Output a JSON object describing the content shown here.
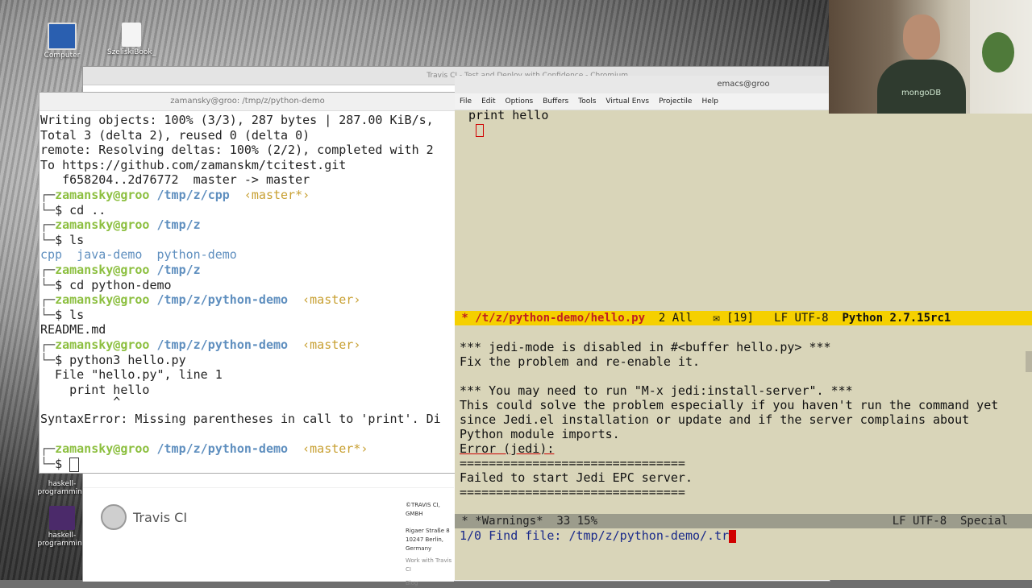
{
  "desktop": {
    "icons": [
      {
        "label": "Computer"
      },
      {
        "label": "SzeliskiBook_"
      },
      {
        "label": "haskell-programming"
      },
      {
        "label": "haskell-programming"
      }
    ]
  },
  "browser": {
    "title": "Travis CI - Test and Deploy with Confidence - Chromium",
    "logo_text": "Travis CI",
    "footer": {
      "copyright": "©TRAVIS CI, GMBH",
      "address_lines": [
        "Rigaer Straße 8",
        "10247 Berlin,",
        "Germany"
      ],
      "links": [
        "Work with Travis CI",
        "Blog"
      ]
    }
  },
  "terminal": {
    "title": "zamansky@groo: /tmp/z/python-demo",
    "lines": {
      "l1": "Writing objects: 100% (3/3), 287 bytes | 287.00 KiB/s,",
      "l2": "Total 3 (delta 2), reused 0 (delta 0)",
      "l3": "remote: Resolving deltas: 100% (2/2), completed with 2",
      "l4": "To https://github.com/zamanskm/tcitest.git",
      "l5": "   f658204..2d76772  master -> master"
    },
    "prompts": [
      {
        "user": "zamansky@groo",
        "path": "/tmp/z/cpp",
        "branch": "‹master*›",
        "cmd": "cd .."
      },
      {
        "user": "zamansky@groo",
        "path": "/tmp/z",
        "branch": "",
        "cmd": "ls"
      },
      {
        "user": "zamansky@groo",
        "path": "/tmp/z",
        "branch": "",
        "cmd": "cd python-demo"
      },
      {
        "user": "zamansky@groo",
        "path": "/tmp/z/python-demo",
        "branch": "‹master›",
        "cmd": "ls"
      },
      {
        "user": "zamansky@groo",
        "path": "/tmp/z/python-demo",
        "branch": "‹master›",
        "cmd": "python3 hello.py"
      },
      {
        "user": "zamansky@groo",
        "path": "/tmp/z/python-demo",
        "branch": "‹master*›",
        "cmd": ""
      }
    ],
    "ls_output": [
      "cpp",
      "java-demo",
      "python-demo"
    ],
    "readme": "README.md",
    "traceback": {
      "file_line": "  File \"hello.py\", line 1",
      "code": "    print hello",
      "caret": "          ^",
      "error": "SyntaxError: Missing parentheses in call to 'print'. Di"
    },
    "prompt_char": "$"
  },
  "emacs": {
    "title": "emacs@groo",
    "menu": [
      "File",
      "Edit",
      "Options",
      "Buffers",
      "Tools",
      "Virtual Envs",
      "Projectile",
      "Help"
    ],
    "code": " print hello",
    "modeline_top": {
      "buffer": " * /t/z/python-demo/hello.py",
      "position": "  2 All",
      "mail": "   ✉ [19]",
      "coding": "   LF UTF-8",
      "mode": "  Python 2.7.15rc1"
    },
    "warnings": [
      "*** jedi-mode is disabled in #<buffer hello.py> ***",
      "Fix the problem and re-enable it.",
      "",
      "*** You may need to run \"M-x jedi:install-server\". ***",
      "This could solve the problem especially if you haven't run the command yet",
      "since Jedi.el installation or update and if the server complains about",
      "Python module imports.",
      "Error (jedi):",
      "===============================",
      "Failed to start Jedi EPC server.",
      "==============================="
    ],
    "modeline_bottom": {
      "buffer": " * *Warnings*  33 15%",
      "coding": "LF UTF-8  Special"
    },
    "minibuffer": "1/0 Find file: /tmp/z/python-demo/.tr"
  },
  "webcam": {
    "shirt_text": "mongoDB"
  }
}
